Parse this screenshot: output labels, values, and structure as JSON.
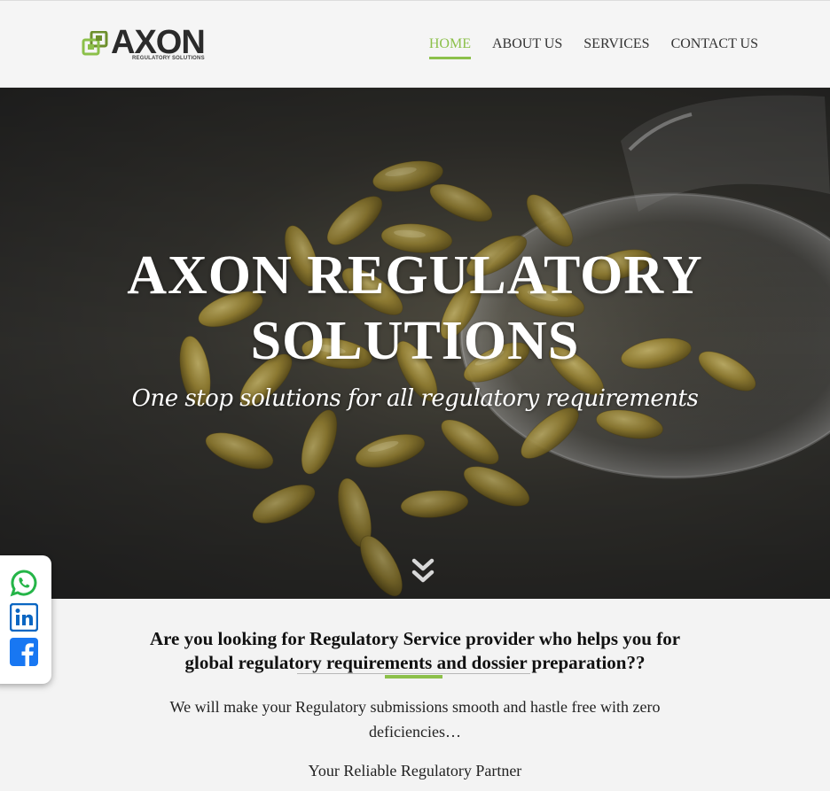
{
  "brand": {
    "name": "AXON",
    "tagline": "REGULATORY SOLUTIONS",
    "accent_color": "#8cc04a"
  },
  "nav": {
    "items": [
      {
        "label": "HOME",
        "active": true
      },
      {
        "label": "ABOUT US",
        "active": false
      },
      {
        "label": "SERVICES",
        "active": false
      },
      {
        "label": "CONTACT US",
        "active": false
      }
    ]
  },
  "hero": {
    "title": "AXON REGULATORY SOLUTIONS",
    "subtitle": "One stop solutions for all regulatory requirements",
    "scroll_icon": "double-chevron-down-icon"
  },
  "social": {
    "items": [
      {
        "name": "whatsapp-icon",
        "color": "#25b548"
      },
      {
        "name": "linkedin-icon",
        "color": "#0a66c2"
      },
      {
        "name": "facebook-icon",
        "color": "#1877f2"
      }
    ]
  },
  "intro": {
    "heading": "Are you looking for Regulatory Service provider who helps you for global regulatory requirements and dossier preparation??",
    "text": "We will make your Regulatory submissions smooth and hastle free with zero deficiencies…",
    "tagline": "Your Reliable Regulatory Partner"
  }
}
